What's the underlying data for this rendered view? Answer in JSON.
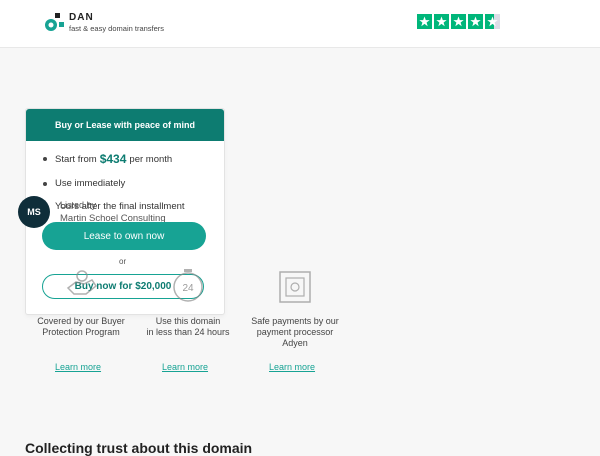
{
  "header": {
    "brand_name": "DAN",
    "tagline": "fast & easy domain transfers",
    "rating_stars": 4.5
  },
  "card": {
    "title": "Buy or Lease with peace of mind",
    "bullets": {
      "start_prefix": "Start from",
      "price": "$434",
      "start_suffix": "per month",
      "item2": "Use immediately",
      "item3": "Yours after the final installment"
    },
    "listed_by": "Listed by",
    "seller_name": "Martin Schoel Consulting",
    "seller_logo_text": "MS",
    "lease_button": "Lease to own now",
    "or_label": "or",
    "buy_button": "Buy now for $20,000"
  },
  "features": [
    {
      "text_line1": "Covered by our Buyer",
      "text_line2": "Protection Program",
      "text_line3": "",
      "link": "Learn more",
      "icon": "buyer-protection-icon"
    },
    {
      "text_line1": "Use this domain",
      "text_line2": "in less than 24 hours",
      "text_line3": "",
      "link": "Learn more",
      "icon": "24-hour-clock-icon",
      "icon_text": "24"
    },
    {
      "text_line1": "Safe payments by our",
      "text_line2": "payment processor",
      "text_line3": "Adyen",
      "link": "Learn more",
      "icon": "safe-icon"
    }
  ],
  "bottom_heading": "Collecting trust about this domain"
}
